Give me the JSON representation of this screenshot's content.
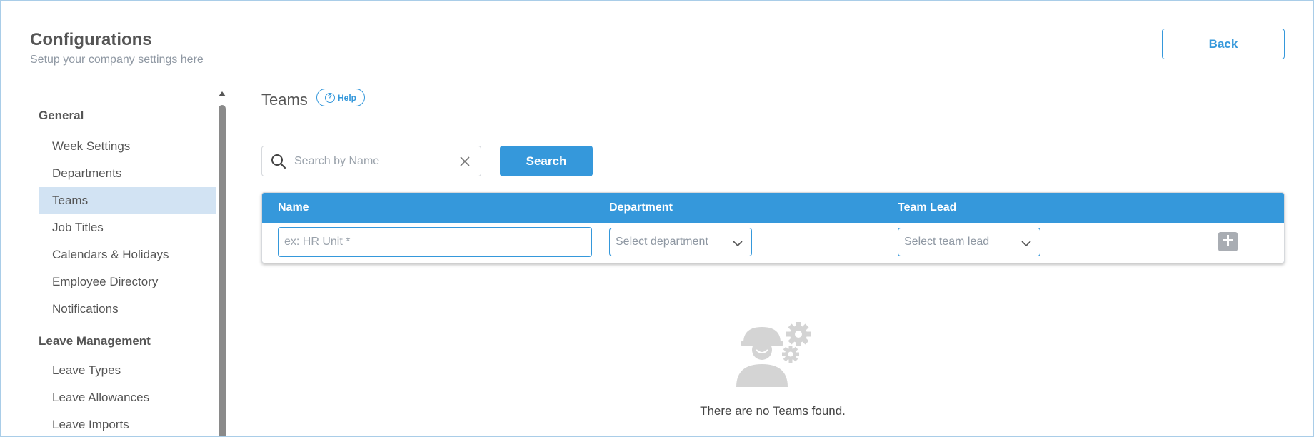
{
  "header": {
    "title": "Configurations",
    "subtitle": "Setup your company settings here",
    "back_label": "Back"
  },
  "sidebar": {
    "sections": [
      {
        "title": "General",
        "items": [
          "Week Settings",
          "Departments",
          "Teams",
          "Job Titles",
          "Calendars & Holidays",
          "Employee Directory",
          "Notifications"
        ]
      },
      {
        "title": "Leave Management",
        "items": [
          "Leave Types",
          "Leave Allowances",
          "Leave Imports"
        ]
      }
    ],
    "active_item": "Teams"
  },
  "main": {
    "title": "Teams",
    "help_label": "Help",
    "search": {
      "placeholder": "Search by Name",
      "button_label": "Search"
    },
    "table": {
      "columns": [
        "Name",
        "Department",
        "Team Lead"
      ],
      "name_placeholder": "ex: HR Unit *",
      "department_placeholder": "Select department",
      "team_lead_placeholder": "Select team lead"
    },
    "empty_message": "There are no Teams found."
  },
  "colors": {
    "accent": "#3598db",
    "active_bg": "#d2e3f3",
    "muted_text": "#8f98a3"
  },
  "icons": [
    "search-icon",
    "clear-icon",
    "help-icon",
    "chevron-down-icon",
    "plus-icon",
    "worker-gears-icon"
  ]
}
